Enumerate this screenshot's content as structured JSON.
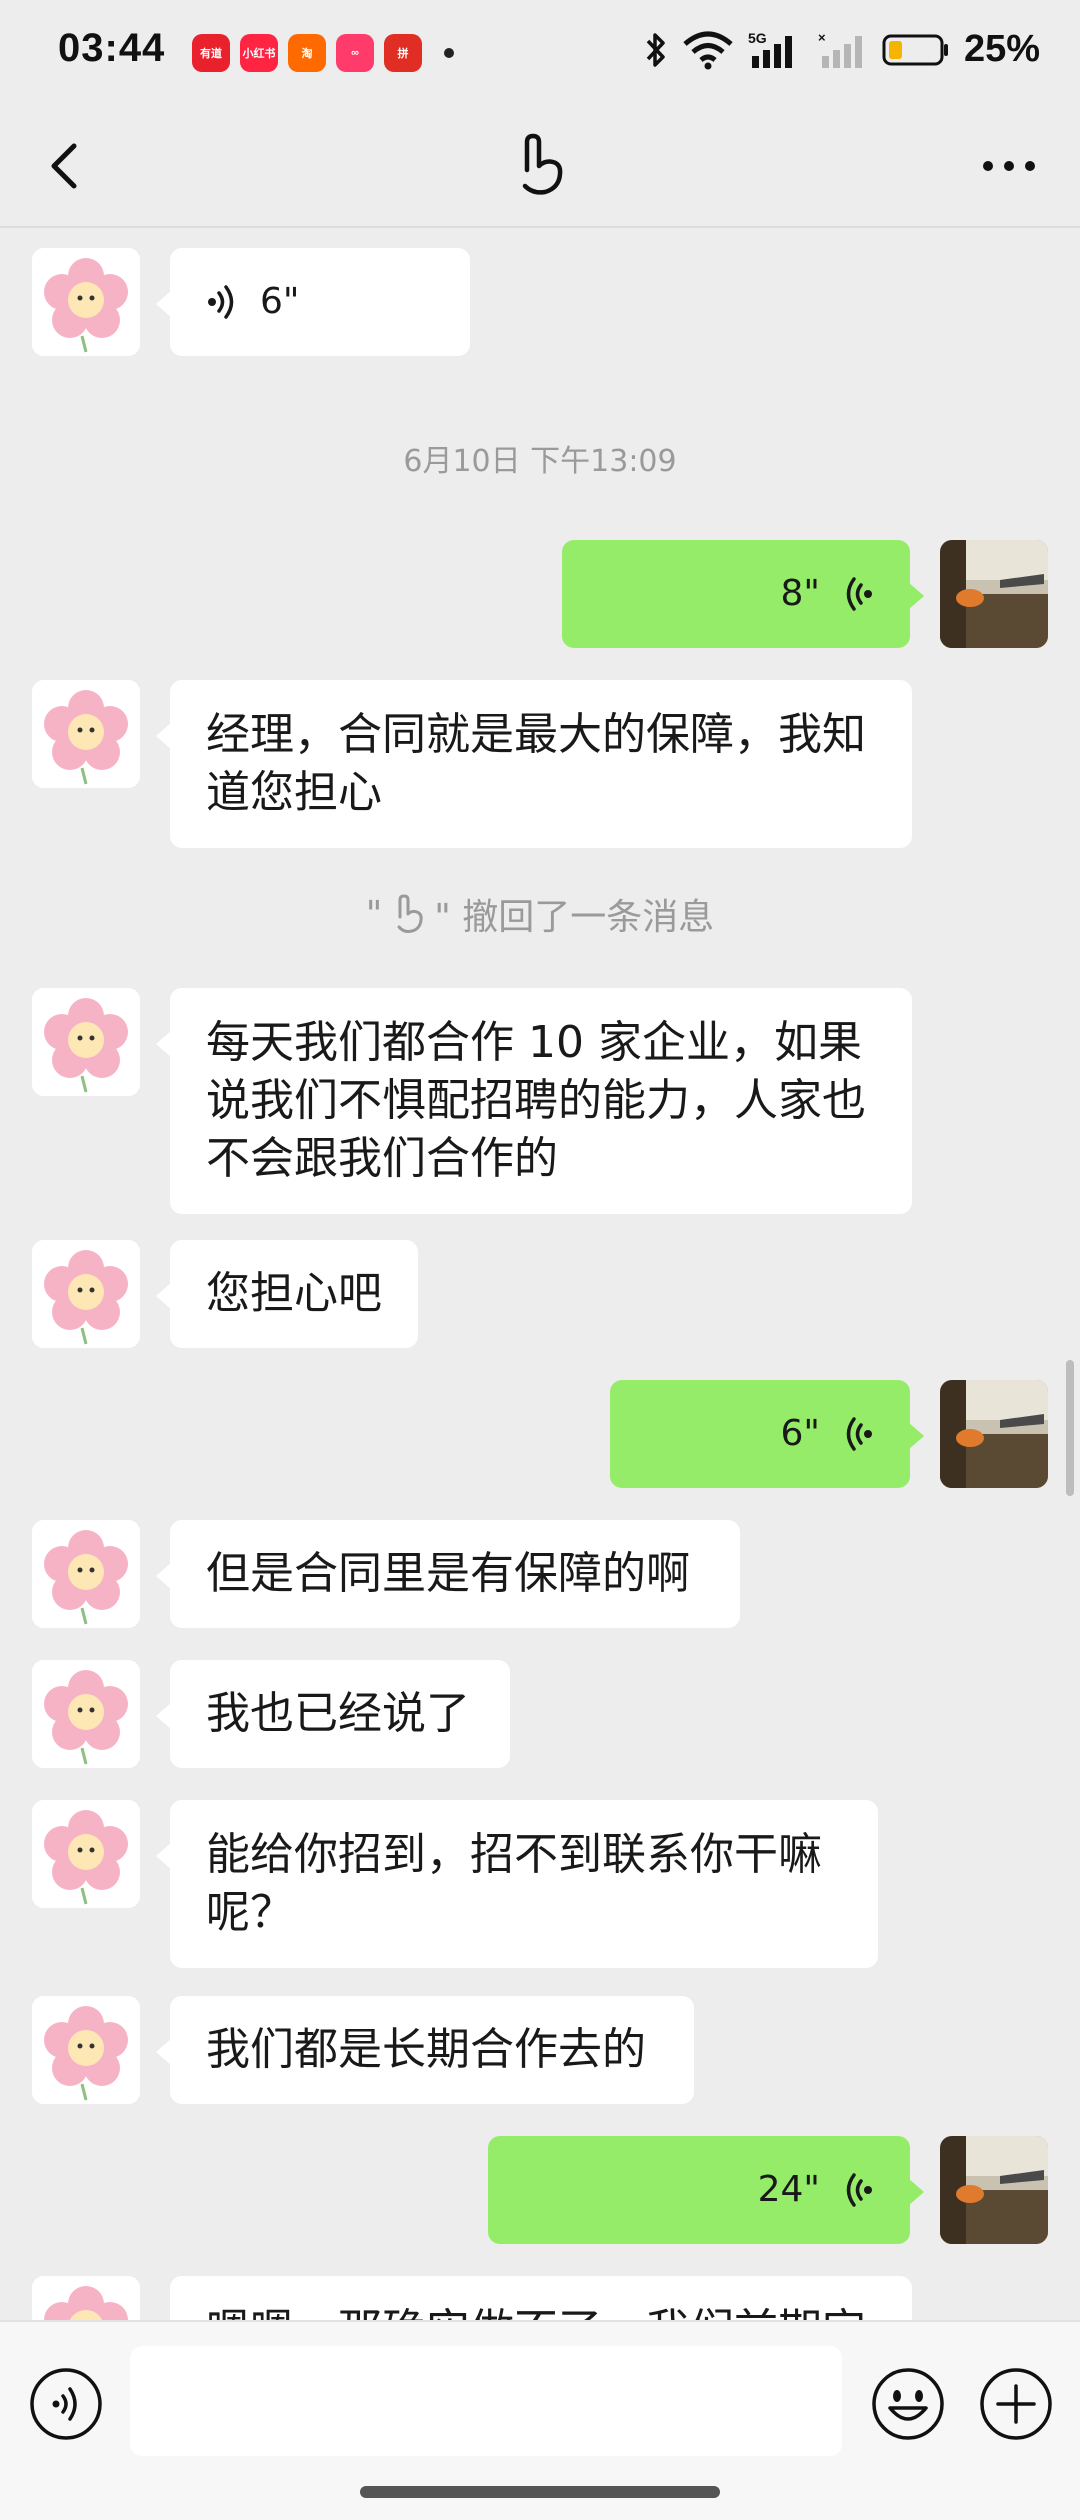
{
  "status_bar": {
    "time": "03:44",
    "battery": "25%",
    "network": "5G",
    "apps": [
      {
        "label": "有道",
        "color": "#e8212d"
      },
      {
        "label": "小红书",
        "color": "#ff2442"
      },
      {
        "label": "淘",
        "color": "#ff6a00"
      },
      {
        "label": "∞",
        "color": "#ff3b6b"
      },
      {
        "label": "拼",
        "color": "#e02e24"
      }
    ]
  },
  "nav": {
    "back_icon": "chevron-left-icon",
    "title_icon": "hand-icon",
    "more_icon": "more-dots-icon"
  },
  "messages": [
    {
      "side": "left",
      "type": "voice",
      "duration": "6\""
    },
    {
      "type": "timestamp",
      "text": "6月10日 下午13:09"
    },
    {
      "side": "right",
      "type": "voice",
      "duration": "8\""
    },
    {
      "side": "left",
      "type": "text",
      "lines": [
        "经理，合同就是最大的保障，我知",
        "道您担心"
      ]
    },
    {
      "type": "recall",
      "text": "\" 撤回了一条消息"
    },
    {
      "side": "left",
      "type": "text",
      "lines": [
        "每天我们都合作 10 家企业，如果",
        "说我们不惧配招聘的能力，人家也",
        "不会跟我们合作的"
      ]
    },
    {
      "side": "left",
      "type": "text",
      "lines": [
        "您担心吧"
      ]
    },
    {
      "side": "right",
      "type": "voice",
      "duration": "6\""
    },
    {
      "side": "left",
      "type": "text",
      "lines": [
        "但是合同里是有保障的啊"
      ]
    },
    {
      "side": "left",
      "type": "text",
      "lines": [
        "我也已经说了"
      ]
    },
    {
      "side": "left",
      "type": "text",
      "lines": [
        "能给你招到，招不到联系你干嘛",
        "呢？"
      ]
    },
    {
      "side": "left",
      "type": "text",
      "lines": [
        "我们都是长期合作去的"
      ]
    },
    {
      "side": "right",
      "type": "voice",
      "duration": "24\""
    },
    {
      "side": "left",
      "type": "text",
      "lines": [
        "嗯嗯，那确实做不了，我们前期定"
      ]
    }
  ],
  "input_bar": {
    "voice_icon": "voice-mode-icon",
    "emoji_icon": "emoji-icon",
    "plus_icon": "plus-icon",
    "placeholder": ""
  },
  "colors": {
    "background": "#ededed",
    "bubble_self": "#95ec69",
    "bubble_other": "#ffffff"
  }
}
